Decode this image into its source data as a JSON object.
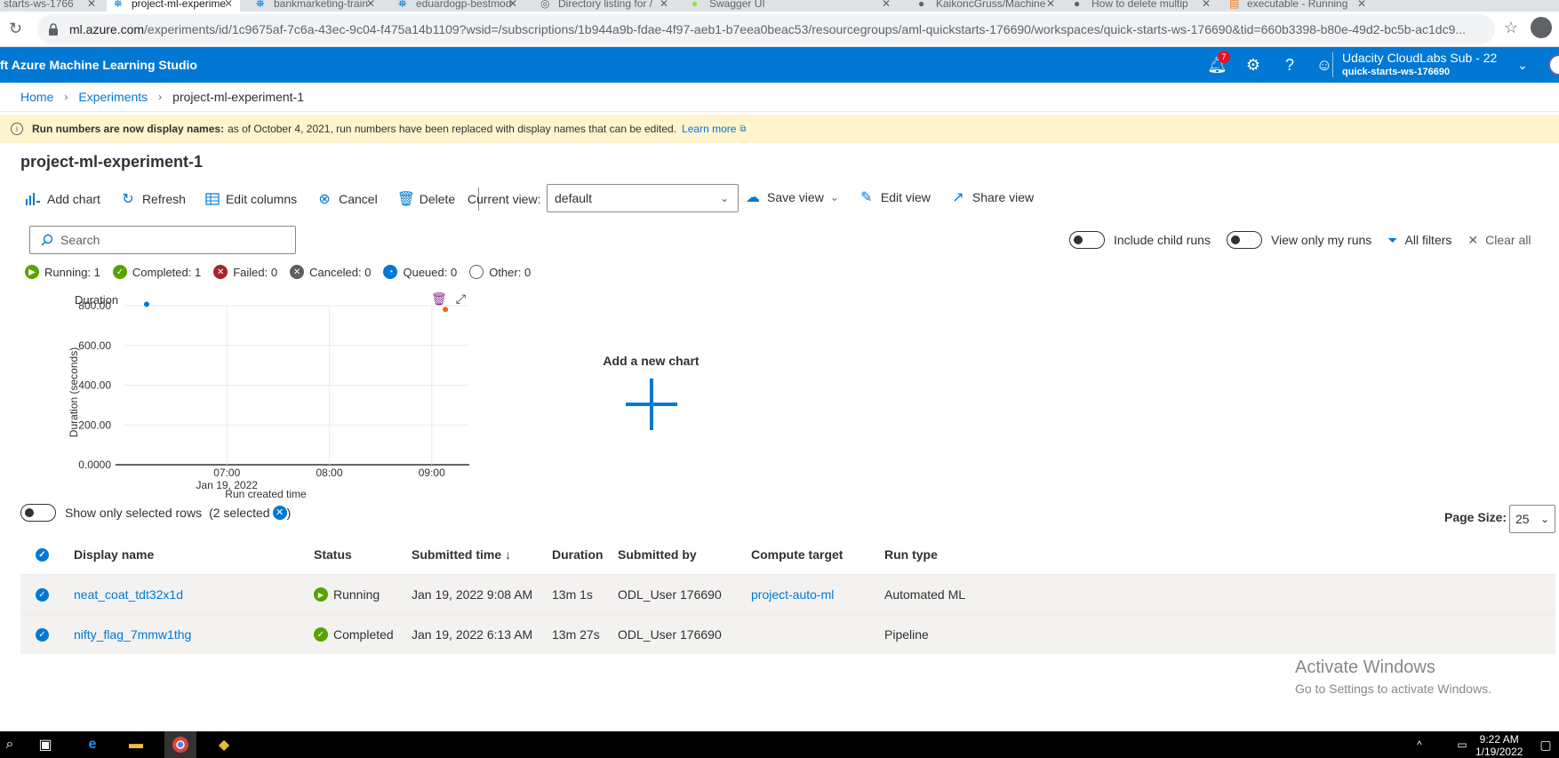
{
  "browser": {
    "tabs": [
      {
        "label": "starts-ws-1766"
      },
      {
        "label": "project-ml-experime"
      },
      {
        "label": "bankmarketing-train"
      },
      {
        "label": "eduardogp-bestmod"
      },
      {
        "label": "Directory listing for /"
      },
      {
        "label": "Swagger UI"
      },
      {
        "label": "KaikoncGruss/Machine"
      },
      {
        "label": "How to delete multip"
      },
      {
        "label": "executable - Running"
      }
    ],
    "url_host": "ml.azure.com",
    "url_path": "/experiments/id/1c9675af-7c6a-43ec-9c04-f475a14b1109?wsid=/subscriptions/1b944a9b-fdae-4f97-aeb1-b7eea0beac53/resourcegroups/aml-quickstarts-176690/workspaces/quick-starts-ws-176690&tid=660b3398-b80e-49d2-bc5b-ac1dc9..."
  },
  "header": {
    "brand": "ft Azure Machine Learning Studio",
    "notification_count": "7",
    "account_name": "Udacity CloudLabs Sub - 22",
    "workspace": "quick-starts-ws-176690"
  },
  "breadcrumb": {
    "home": "Home",
    "experiments": "Experiments",
    "current": "project-ml-experiment-1"
  },
  "banner": {
    "title": "Run numbers are now display names:",
    "text": "as of October 4, 2021, run numbers have been replaced with display names that can be edited.",
    "link": "Learn more"
  },
  "page_title": "project-ml-experiment-1",
  "toolbar": {
    "add_chart": "Add chart",
    "refresh": "Refresh",
    "edit_columns": "Edit columns",
    "cancel": "Cancel",
    "delete": "Delete",
    "current_view_label": "Current view:",
    "current_view_value": "default",
    "save_view": "Save view",
    "edit_view": "Edit view",
    "share_view": "Share view"
  },
  "search": {
    "placeholder": "Search"
  },
  "filters": {
    "include_child_runs": "Include child runs",
    "view_only_my_runs": "View only my runs",
    "all_filters": "All filters",
    "clear_all": "Clear all"
  },
  "status_counts": [
    {
      "label": "Running: 1",
      "color": "#57a300",
      "glyph": "▶"
    },
    {
      "label": "Completed: 1",
      "color": "#57a300",
      "glyph": "✓"
    },
    {
      "label": "Failed: 0",
      "color": "#a4262c",
      "glyph": "✕"
    },
    {
      "label": "Canceled: 0",
      "color": "#605e5c",
      "glyph": "✕"
    },
    {
      "label": "Queued: 0",
      "color": "#0078d4",
      "glyph": "◔"
    },
    {
      "label": "Other: 0",
      "color": "#ffffff",
      "glyph": ""
    }
  ],
  "chart_data": {
    "type": "scatter",
    "title": "Duration",
    "xlabel": "Run created time",
    "ylabel": "Duration (seconds)",
    "x_ticks": [
      "07:00",
      "08:00",
      "09:00"
    ],
    "x_date_label": "Jan 19, 2022",
    "y_ticks": [
      "0.0000",
      "200.00",
      "400.00",
      "600.00",
      "800.00"
    ],
    "ylim": [
      0,
      800
    ],
    "series": [
      {
        "x": "06:13",
        "y": 807,
        "color": "#0078d4"
      },
      {
        "x": "09:08",
        "y": 781,
        "color": "#f7630c"
      }
    ]
  },
  "add_new_chart": "Add a new chart",
  "selection": {
    "label": "Show only selected rows",
    "count": "(2 selected",
    "close": ")"
  },
  "page_size": {
    "label": "Page Size:",
    "value": "25"
  },
  "table": {
    "columns": [
      "Display name",
      "Status",
      "Submitted time ↓",
      "Duration",
      "Submitted by",
      "Compute target",
      "Run type"
    ],
    "rows": [
      {
        "name": "neat_coat_tdt32x1d",
        "status": "Running",
        "submitted": "Jan 19, 2022 9:08 AM",
        "duration": "13m 1s",
        "by": "ODL_User 176690",
        "compute": "project-auto-ml",
        "type": "Automated ML"
      },
      {
        "name": "nifty_flag_7mmw1thg",
        "status": "Completed",
        "submitted": "Jan 19, 2022 6:13 AM",
        "duration": "13m 27s",
        "by": "ODL_User 176690",
        "compute": "",
        "type": "Pipeline"
      }
    ]
  },
  "watermark": {
    "line1": "Activate Windows",
    "line2": "Go to Settings to activate Windows."
  },
  "taskbar": {
    "time": "9:22 AM",
    "date": "1/19/2022"
  }
}
